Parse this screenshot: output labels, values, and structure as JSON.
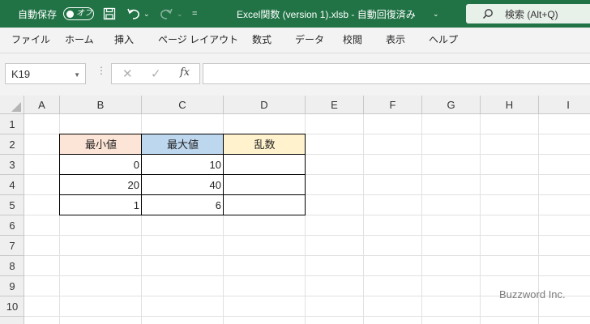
{
  "titlebar": {
    "autosave_label": "自動保存",
    "autosave_state": "オフ",
    "save_icon": "save-icon",
    "undo_icon": "undo-icon",
    "redo_icon": "redo-icon",
    "customize_qat": "=",
    "document_title": "Excel関数 (version 1).xlsb  -  自動回復済み",
    "search_placeholder": "検索 (Alt+Q)",
    "bg_color": "#217346"
  },
  "ribbon_tabs": [
    "ファイル",
    "ホーム",
    "挿入",
    "ページ レイアウト",
    "数式",
    "データ",
    "校閲",
    "表示",
    "ヘルプ"
  ],
  "formula_bar": {
    "name_box": "K19",
    "function_button": "fx",
    "formula": ""
  },
  "sheet": {
    "columns": [
      "A",
      "B",
      "C",
      "D",
      "E",
      "F",
      "G",
      "H",
      "I"
    ],
    "rows": [
      "1",
      "2",
      "3",
      "4",
      "5",
      "6",
      "7",
      "8",
      "9",
      "10"
    ],
    "table": {
      "headers": [
        "最小値",
        "最大値",
        "乱数"
      ],
      "header_colors": [
        "#fce4d6",
        "#bdd7ee",
        "#fff2cc"
      ],
      "rows": [
        [
          "0",
          "10",
          ""
        ],
        [
          "20",
          "40",
          ""
        ],
        [
          "1",
          "6",
          ""
        ]
      ]
    }
  },
  "watermark": "Buzzword Inc."
}
